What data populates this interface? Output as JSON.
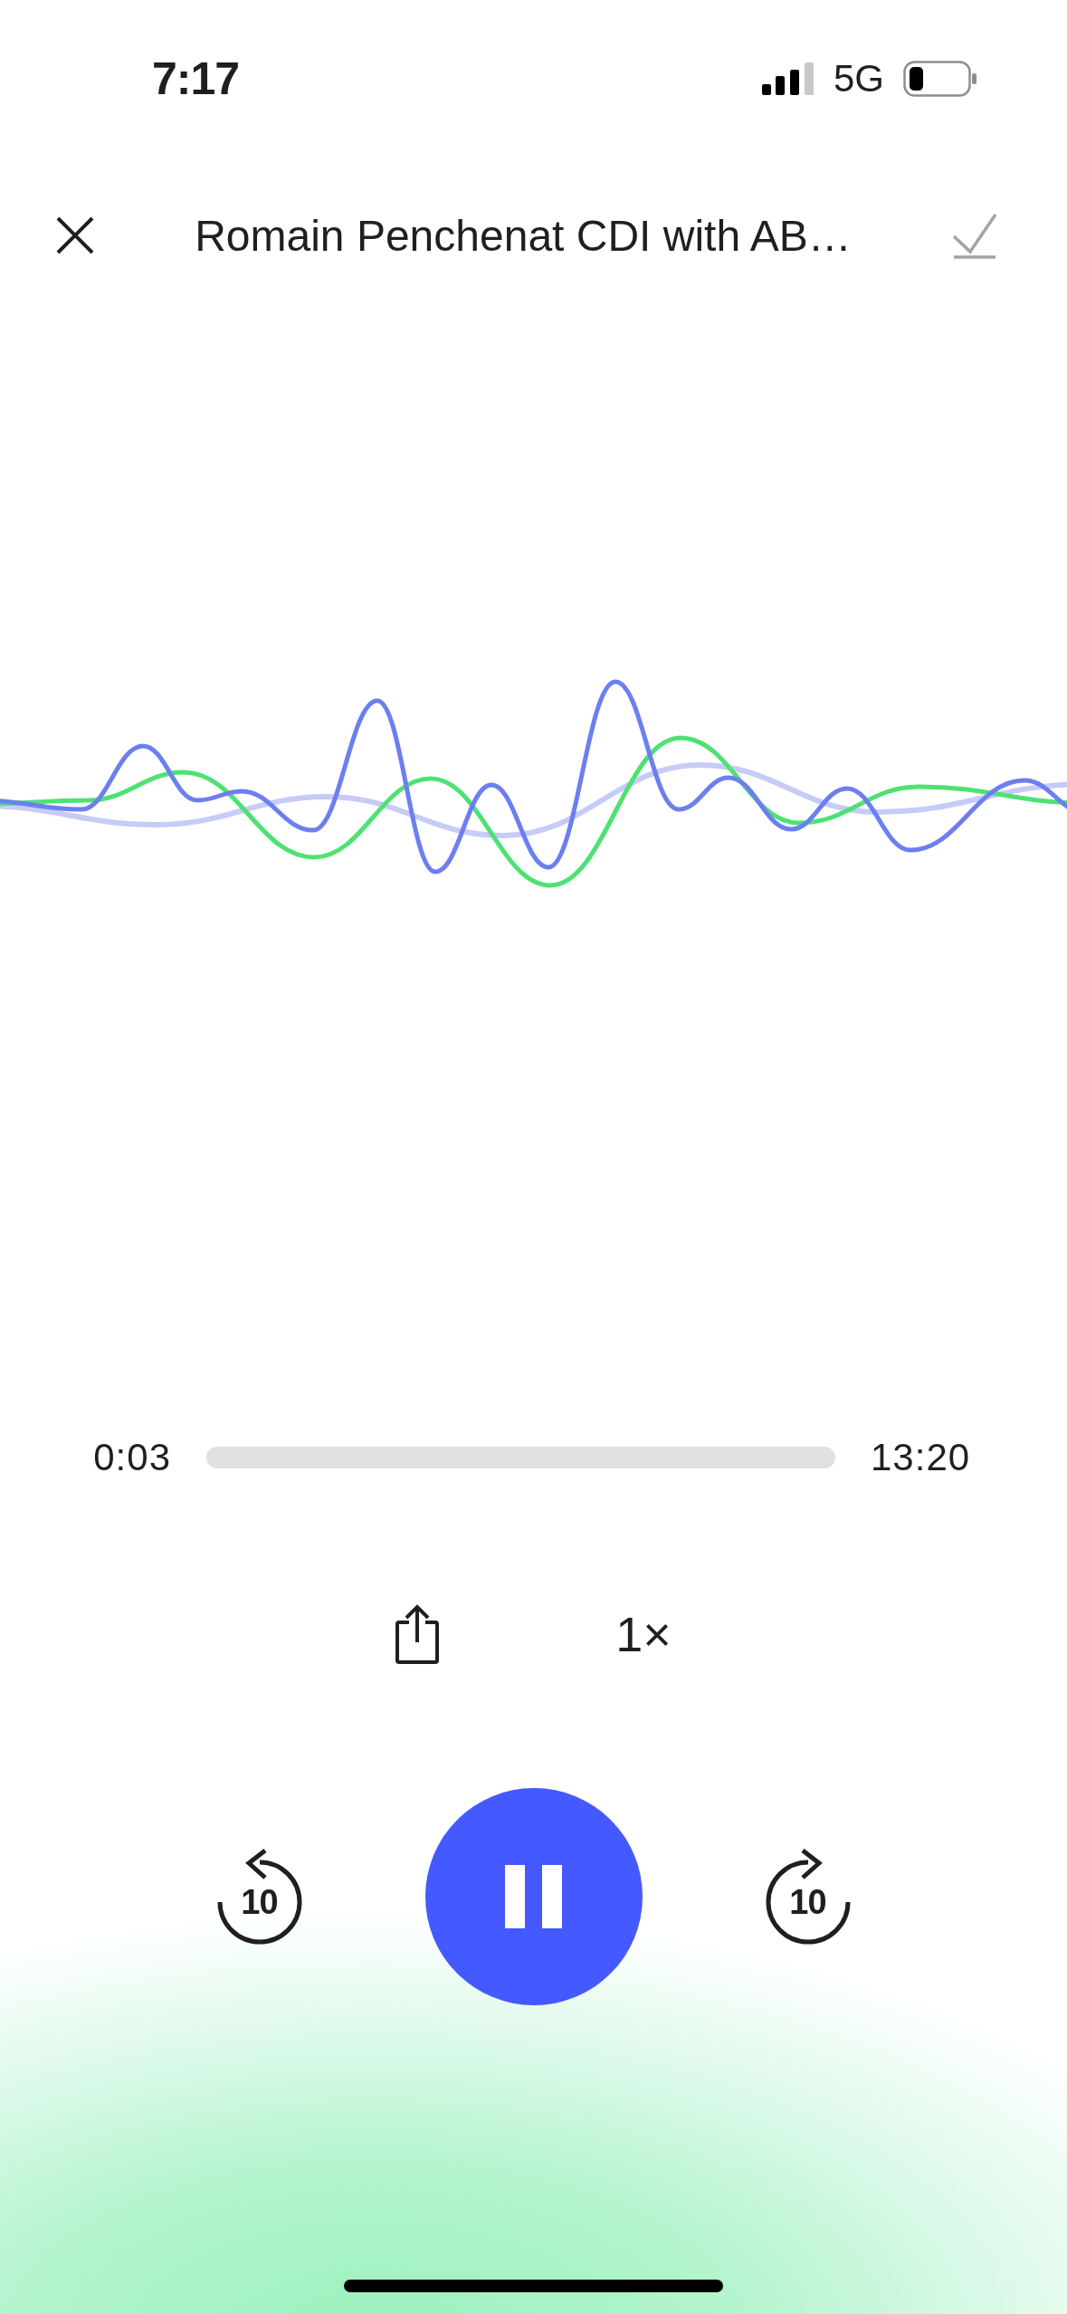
{
  "status_bar": {
    "time": "7:17",
    "network": "5G"
  },
  "header": {
    "title": "Romain Penchenat CDI with AB…",
    "done_disabled": true
  },
  "progress": {
    "elapsed": "0:03",
    "duration": "13:20"
  },
  "options": {
    "speed": "1×"
  },
  "controls": {
    "skip_back": "10",
    "playing": true,
    "skip_forward": "10"
  }
}
